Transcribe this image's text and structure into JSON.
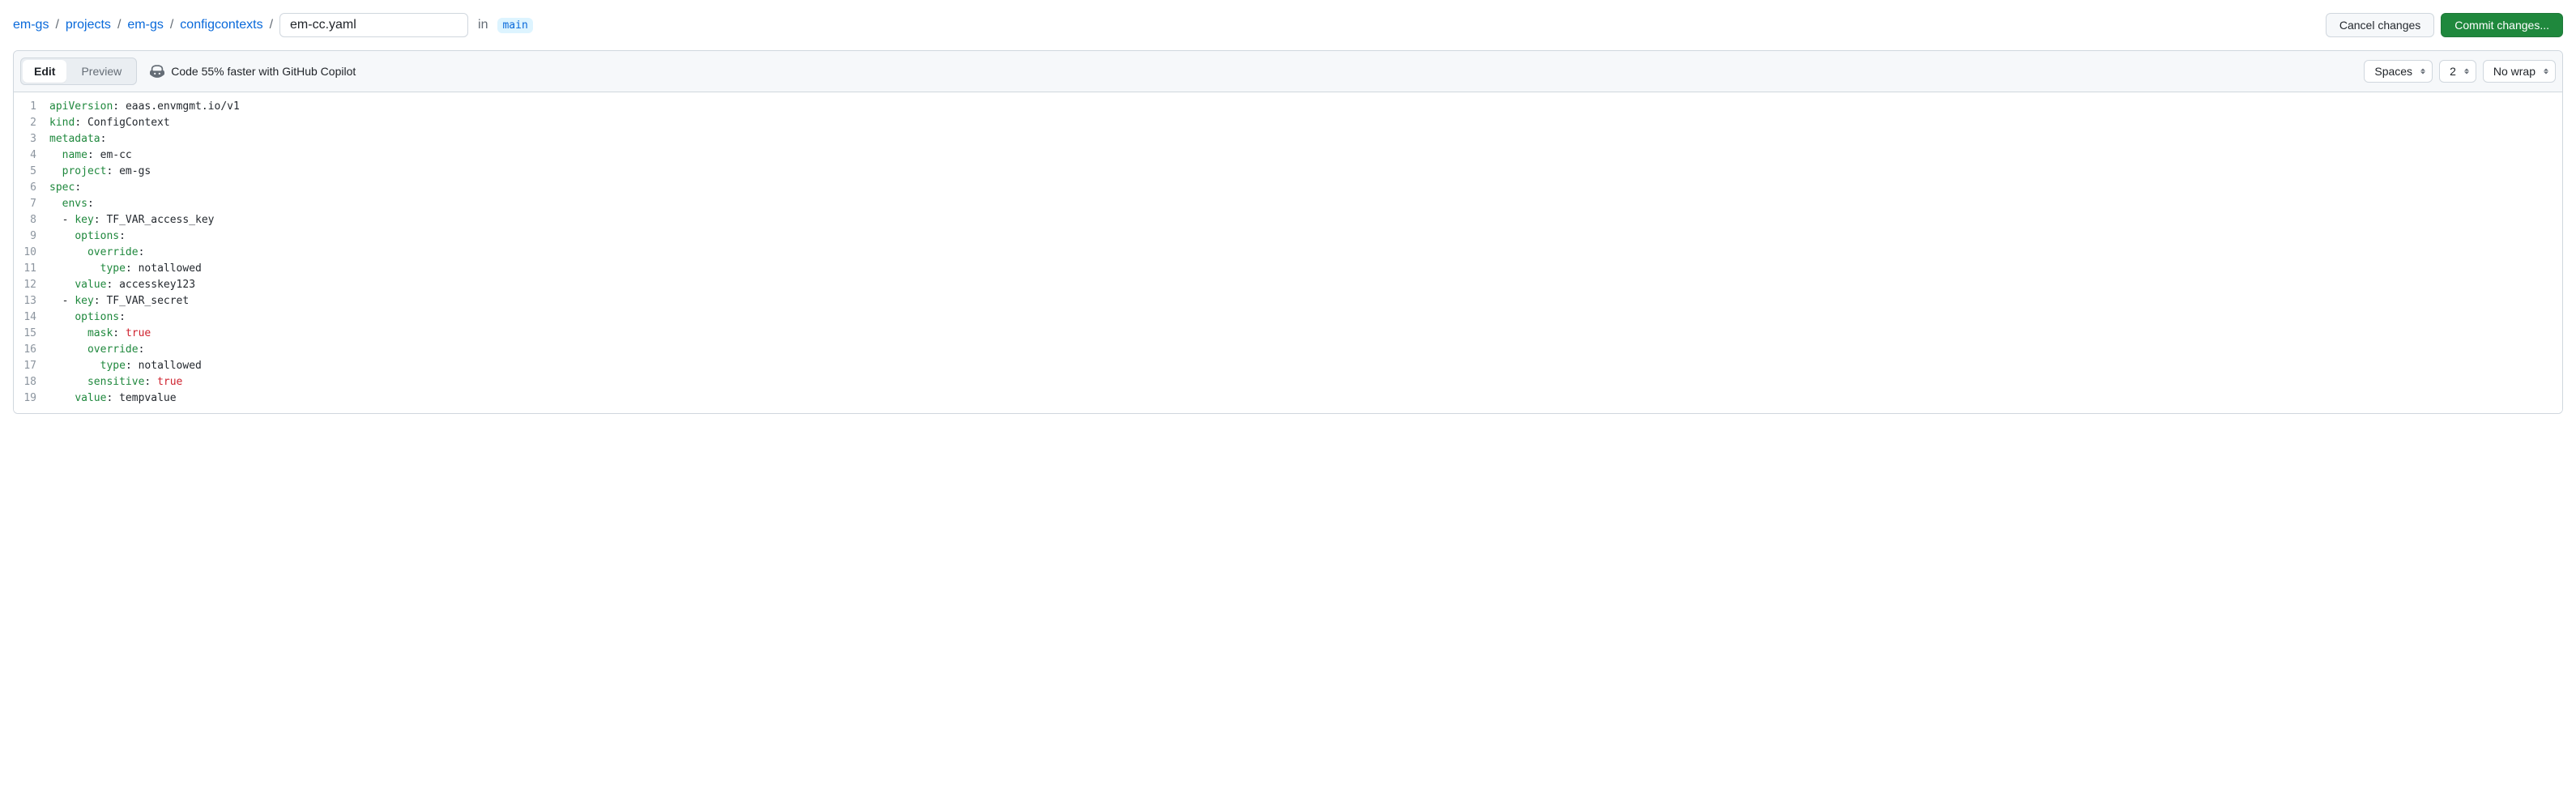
{
  "breadcrumbs": {
    "parts": [
      "em-gs",
      "projects",
      "em-gs",
      "configcontexts"
    ],
    "sep": "/",
    "filename": "em-cc.yaml",
    "in_label": "in",
    "branch": "main"
  },
  "actions": {
    "cancel": "Cancel changes",
    "commit": "Commit changes..."
  },
  "tabs": {
    "edit": "Edit",
    "preview": "Preview"
  },
  "copilot": {
    "message": "Code 55% faster with GitHub Copilot"
  },
  "editor_settings": {
    "indent_mode": "Spaces",
    "indent_size": "2",
    "wrap_mode": "No wrap"
  },
  "code": {
    "lines": [
      {
        "n": 1,
        "indent": 0,
        "key": "apiVersion",
        "value": "eaas.envmgmt.io/v1"
      },
      {
        "n": 2,
        "indent": 0,
        "key": "kind",
        "value": "ConfigContext"
      },
      {
        "n": 3,
        "indent": 0,
        "key": "metadata",
        "value": null
      },
      {
        "n": 4,
        "indent": 1,
        "key": "name",
        "value": "em-cc"
      },
      {
        "n": 5,
        "indent": 1,
        "key": "project",
        "value": "em-gs"
      },
      {
        "n": 6,
        "indent": 0,
        "key": "spec",
        "value": null
      },
      {
        "n": 7,
        "indent": 1,
        "key": "envs",
        "value": null
      },
      {
        "n": 8,
        "indent": 1,
        "dash": true,
        "key": "key",
        "value": "TF_VAR_access_key"
      },
      {
        "n": 9,
        "indent": 2,
        "key": "options",
        "value": null
      },
      {
        "n": 10,
        "indent": 3,
        "key": "override",
        "value": null
      },
      {
        "n": 11,
        "indent": 4,
        "key": "type",
        "value": "notallowed"
      },
      {
        "n": 12,
        "indent": 2,
        "key": "value",
        "value": "accesskey123"
      },
      {
        "n": 13,
        "indent": 1,
        "dash": true,
        "key": "key",
        "value": "TF_VAR_secret"
      },
      {
        "n": 14,
        "indent": 2,
        "key": "options",
        "value": null
      },
      {
        "n": 15,
        "indent": 3,
        "key": "mask",
        "value": "true",
        "bool": true
      },
      {
        "n": 16,
        "indent": 3,
        "key": "override",
        "value": null
      },
      {
        "n": 17,
        "indent": 4,
        "key": "type",
        "value": "notallowed"
      },
      {
        "n": 18,
        "indent": 3,
        "key": "sensitive",
        "value": "true",
        "bool": true
      },
      {
        "n": 19,
        "indent": 2,
        "key": "value",
        "value": "tempvalue"
      }
    ]
  }
}
